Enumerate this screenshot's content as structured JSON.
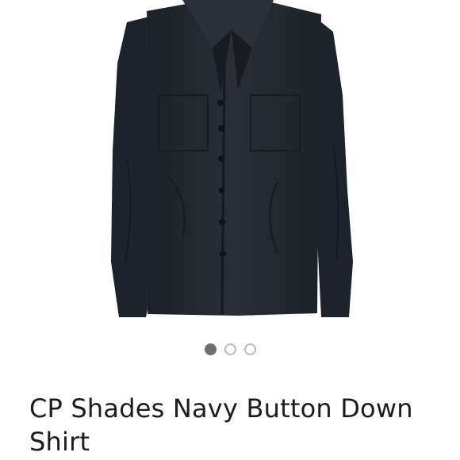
{
  "listing": {
    "title": "CP Shades Navy Button Down Shirt",
    "image": {
      "subject": "navy button-down shirt",
      "main_color": "#22262d"
    }
  },
  "carousel": {
    "count": 3,
    "active_index": 0,
    "active_color": "#6f6f6f",
    "inactive_color": "#b8b8b8"
  }
}
